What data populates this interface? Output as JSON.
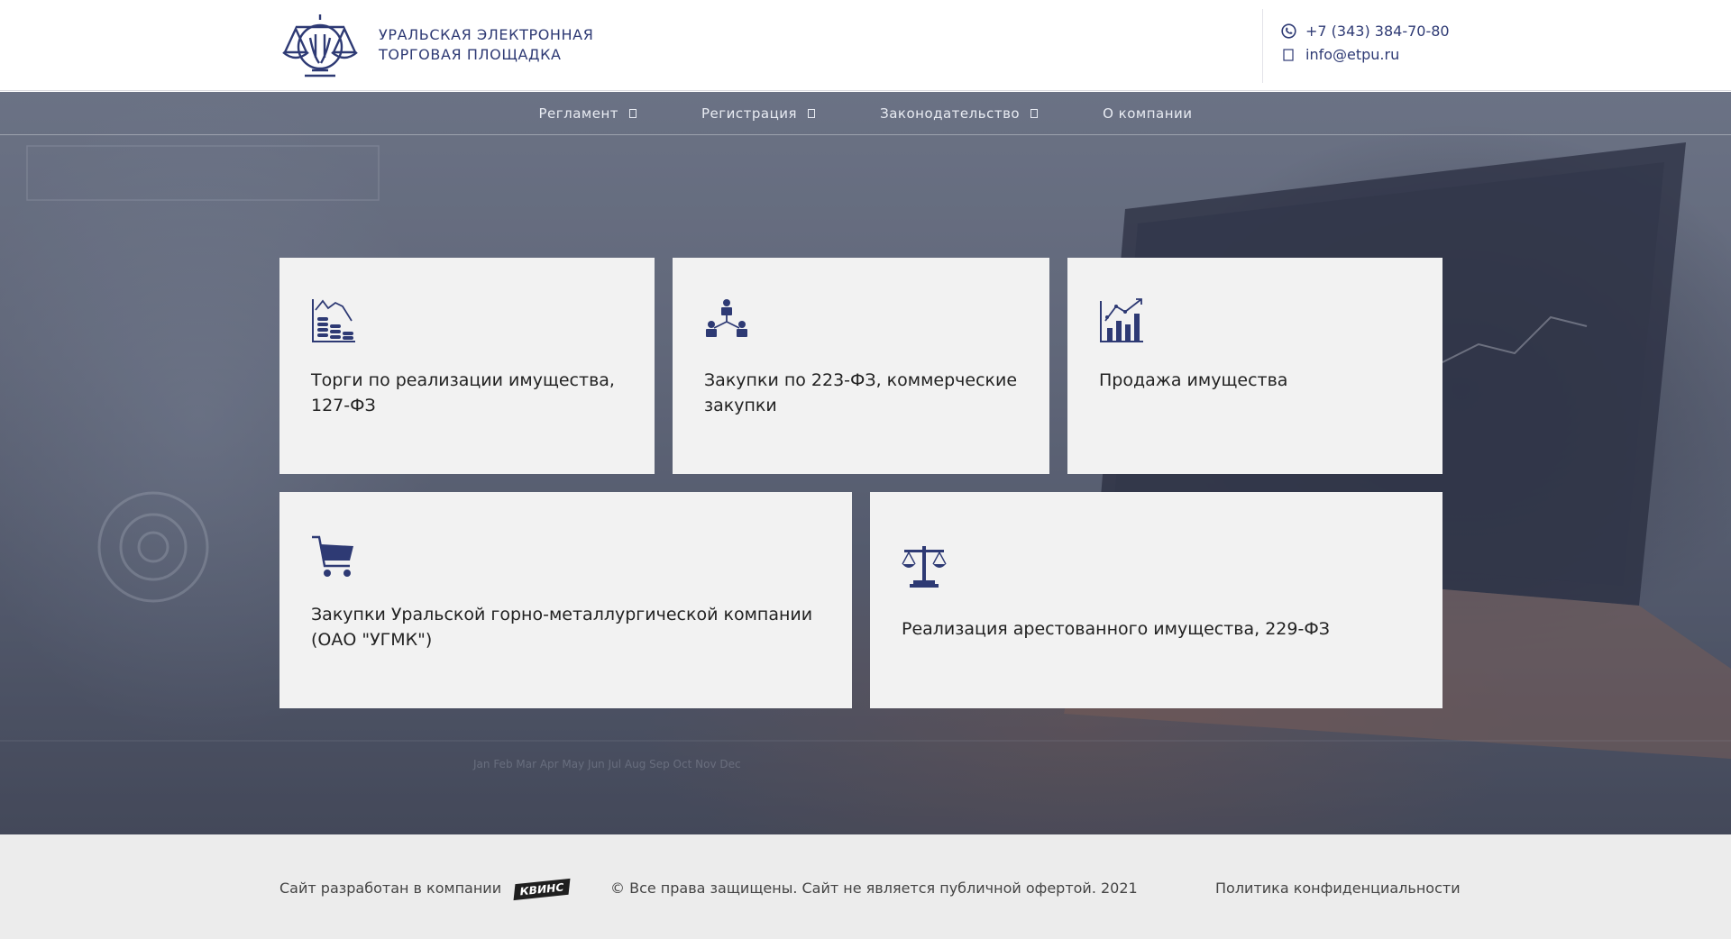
{
  "header": {
    "brand_line1": "УРАЛЬСКАЯ ЭЛЕКТРОННАЯ",
    "brand_line2": "ТОРГОВАЯ ПЛОЩАДКА",
    "phone": "+7 (343) 384-70-80",
    "email": "info@etpu.ru",
    "icons": {
      "logo": "scales-logo",
      "phone": "phone-icon",
      "mail": "mail-icon"
    }
  },
  "nav": {
    "items": [
      {
        "label": "Регламент",
        "has_dropdown": true
      },
      {
        "label": "Регистрация",
        "has_dropdown": true
      },
      {
        "label": "Законодательство",
        "has_dropdown": true
      },
      {
        "label": "О компании",
        "has_dropdown": false
      }
    ]
  },
  "cards": [
    {
      "title": "Торги по реализации имущества, 127-ФЗ",
      "icon": "coins-chart-icon"
    },
    {
      "title": "Закупки по 223-ФЗ, коммерческие закупки",
      "icon": "org-hierarchy-icon"
    },
    {
      "title": "Продажа имущества",
      "icon": "bar-chart-icon"
    },
    {
      "title": "Закупки Уральской горно-металлургической компании (ОАО \"УГМК\")",
      "icon": "shopping-cart-icon"
    },
    {
      "title": "Реализация арестованного имущества, 229-ФЗ",
      "icon": "scales-icon"
    }
  ],
  "footer": {
    "developer_text": "Сайт разработан в компании",
    "developer_logo": "КВИНС",
    "copyright": "© Все права защищены. Сайт не является публичной офертой. 2021",
    "privacy_link": "Политика конфиденциальности"
  },
  "colors": {
    "accent": "#2e3a74",
    "card_bg": "#f2f2f2",
    "footer_bg": "#ececec"
  }
}
